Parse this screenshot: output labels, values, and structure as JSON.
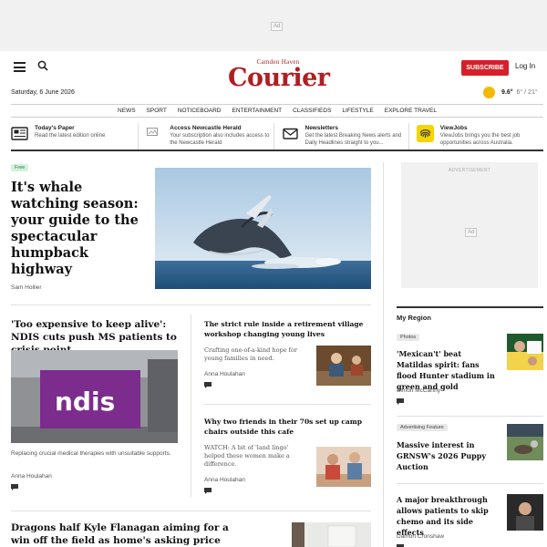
{
  "top_ad": {
    "label": "Ad"
  },
  "masthead": {
    "logo_top": "Camden Haven",
    "logo_main": "Courier",
    "subscribe": "SUBSCRIBE",
    "login": "Log In",
    "date": "Saturday, 6 June 2026",
    "weather": {
      "current": "9.6°",
      "range": "6° / 21°",
      "icon": "sun-icon"
    }
  },
  "nav": [
    "NEWS",
    "SPORT",
    "NOTICEBOARD",
    "ENTERTAINMENT",
    "CLASSIFIEDS",
    "LIFESTYLE",
    "EXPLORE TRAVEL"
  ],
  "promos": [
    {
      "title": "Today's Paper",
      "desc": "Read the latest edition online",
      "icon": "newspaper-icon"
    },
    {
      "title": "Access Newcastle Herald",
      "desc": "Your subscription also includes access to the Newcastle Herald",
      "icon": "broken-image-icon"
    },
    {
      "title": "Newsletters",
      "desc": "Get the latest Breaking News alerts and Daily Headlines straight to you...",
      "icon": "envelope-icon"
    },
    {
      "title": "ViewJobs",
      "desc": "ViewJobs brings you the best job opportunities across Australia.",
      "icon": "fingerprint-icon"
    }
  ],
  "lead": {
    "badge": "Free",
    "headline": "It's whale watching season: your guide to the spectacular humpback highway",
    "author": "Sam Hollier"
  },
  "story_ndis": {
    "headline": "'Too expensive to keep alive': NDIS cuts push MS patients to crisis point",
    "standfirst": "Replacing crucial medical therapies with unsuitable supports.",
    "author": "Anna Houlahan",
    "image_text": "ndis"
  },
  "story_village": {
    "headline": "The strict rule inside a retirement village workshop changing young lives",
    "standfirst": "Crafting one-of-a-kind hope for young families in need.",
    "author": "Anna Houlahan"
  },
  "story_cafe": {
    "headline": "Why two friends in their 70s set up camp chairs outside this cafe",
    "standfirst": "WATCH: A bit of 'land lingo' helped these women make a difference.",
    "author": "Anna Houlahan"
  },
  "story_flanagan": {
    "headline": "Dragons half Kyle Flanagan aiming for a win off the field as home's asking price revealed"
  },
  "sidebar": {
    "ad_label": "ADVERTISEMENT",
    "ad_mark": "Ad",
    "region_title": "My Region",
    "items": [
      {
        "badge": "Photos",
        "headline": "'Mexican't' beat Matildas spirit: fans flood Hunter stadium in green and gold",
        "author": "Simon McCarthy"
      },
      {
        "badge": "Advertising Feature",
        "headline": "Massive interest in GRNSW's 2026 Puppy Auction",
        "author": ""
      },
      {
        "badge": "",
        "headline": "A major breakthrough allows patients to skip chemo and its side effects",
        "author": "Damon Cronshaw"
      }
    ]
  },
  "colors": {
    "brand_red": "#b01e23",
    "subscribe_red": "#d4202b",
    "free_green": "#1a7f3c"
  }
}
